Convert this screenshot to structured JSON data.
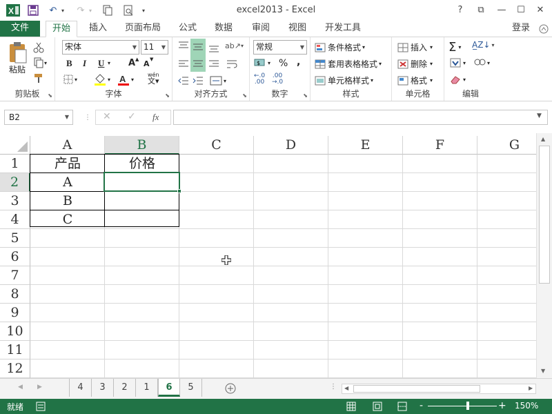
{
  "app": {
    "title": "excel2013 - Excel"
  },
  "window": {
    "help": "?",
    "restore_ribbon": "⧉",
    "minimize": "—",
    "maximize": "☐",
    "close": "✕"
  },
  "tabs": [
    {
      "label": "文件"
    },
    {
      "label": "开始"
    },
    {
      "label": "插入"
    },
    {
      "label": "页面布局"
    },
    {
      "label": "公式"
    },
    {
      "label": "数据"
    },
    {
      "label": "审阅"
    },
    {
      "label": "视图"
    },
    {
      "label": "开发工具"
    }
  ],
  "login": "登录",
  "ribbon": {
    "clipboard": {
      "label": "剪贴板",
      "paste": "粘贴"
    },
    "font": {
      "label": "字体",
      "name": "宋体",
      "size": "11",
      "bold": "B",
      "italic": "I",
      "underline": "U",
      "grow": "A",
      "shrink": "A",
      "wen": "wén"
    },
    "align": {
      "label": "对齐方式"
    },
    "number": {
      "label": "数字",
      "format": "常规",
      "percent": "%",
      "comma": ",",
      "inc": "←.0\n.00",
      "dec": ".00\n→.0"
    },
    "styles": {
      "label": "样式",
      "cond": "条件格式",
      "table": "套用表格格式",
      "cell": "单元格样式"
    },
    "cells": {
      "label": "单元格",
      "insert": "插入",
      "delete": "删除",
      "format": "格式"
    },
    "edit": {
      "label": "编辑"
    }
  },
  "formula_bar": {
    "name_box": "B2",
    "fx": "fx",
    "value": ""
  },
  "columns": [
    "A",
    "B",
    "C",
    "D",
    "E",
    "F",
    "G"
  ],
  "rows": [
    "1",
    "2",
    "3",
    "4",
    "5",
    "6",
    "7",
    "8",
    "9",
    "10",
    "11",
    "12"
  ],
  "cells": {
    "A1": "产品",
    "B1": "价格",
    "A2": "A",
    "A3": "B",
    "A4": "C"
  },
  "sheets": [
    "4",
    "3",
    "2",
    "1",
    "6",
    "5"
  ],
  "active_sheet": "6",
  "status": {
    "ready": "就绪",
    "zoom": "150%",
    "minus": "-",
    "plus": "+"
  },
  "colors": {
    "accent": "#217346",
    "selection": "#217346"
  }
}
